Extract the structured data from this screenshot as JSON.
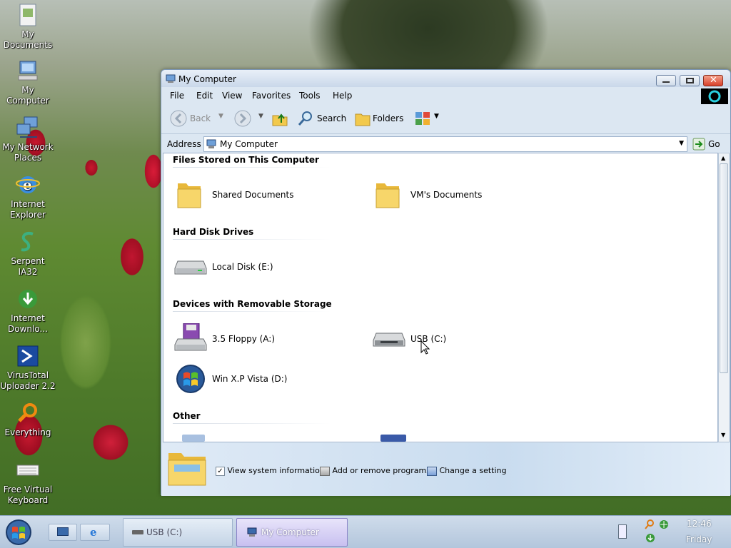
{
  "desktop": {
    "icons": [
      {
        "label": "My Documents",
        "icon": "my-documents-icon"
      },
      {
        "label": "My Computer",
        "icon": "my-computer-icon"
      },
      {
        "label": "My Network Places",
        "icon": "network-places-icon"
      },
      {
        "label": "Internet Explorer",
        "icon": "internet-explorer-icon"
      },
      {
        "label": "Serpent IA32",
        "icon": "serpent-icon"
      },
      {
        "label": "Internet Downlo...",
        "icon": "internet-download-icon"
      },
      {
        "label": "VirusTotal Uploader 2.2",
        "icon": "virustotal-icon"
      },
      {
        "label": "Everything",
        "icon": "everything-icon"
      },
      {
        "label": "Free Virtual Keyboard",
        "icon": "keyboard-icon"
      }
    ]
  },
  "window": {
    "title": "My Computer",
    "menu": [
      "File",
      "Edit",
      "View",
      "Favorites",
      "Tools",
      "Help"
    ],
    "toolbar": {
      "back": "Back",
      "search": "Search",
      "folders": "Folders"
    },
    "address": {
      "label": "Address",
      "value": "My Computer",
      "go": "Go"
    },
    "groups": [
      {
        "title": "Files Stored on This Computer"
      },
      {
        "title": "Hard Disk Drives"
      },
      {
        "title": "Devices with Removable Storage"
      },
      {
        "title": "Other"
      }
    ],
    "items": {
      "shared_documents": "Shared Documents",
      "vm_documents": "VM's Documents",
      "local_disk": "Local Disk (E:)",
      "floppy": "3.5 Floppy (A:)",
      "usb": "USB (C:)",
      "winxp": "Win X.P Vista (D:)"
    },
    "tasks": [
      "View system information",
      "Add or remove programs",
      "Change a setting"
    ]
  },
  "taskbar": {
    "buttons": [
      {
        "label": "USB (C:)"
      },
      {
        "label": "My Computer"
      }
    ],
    "clock": {
      "time": "12:46",
      "day": "Friday"
    }
  },
  "colors": {
    "accent": "#1f4f8f",
    "window_bg": "#dce7f2",
    "taskbar": "#c4d4e6"
  }
}
